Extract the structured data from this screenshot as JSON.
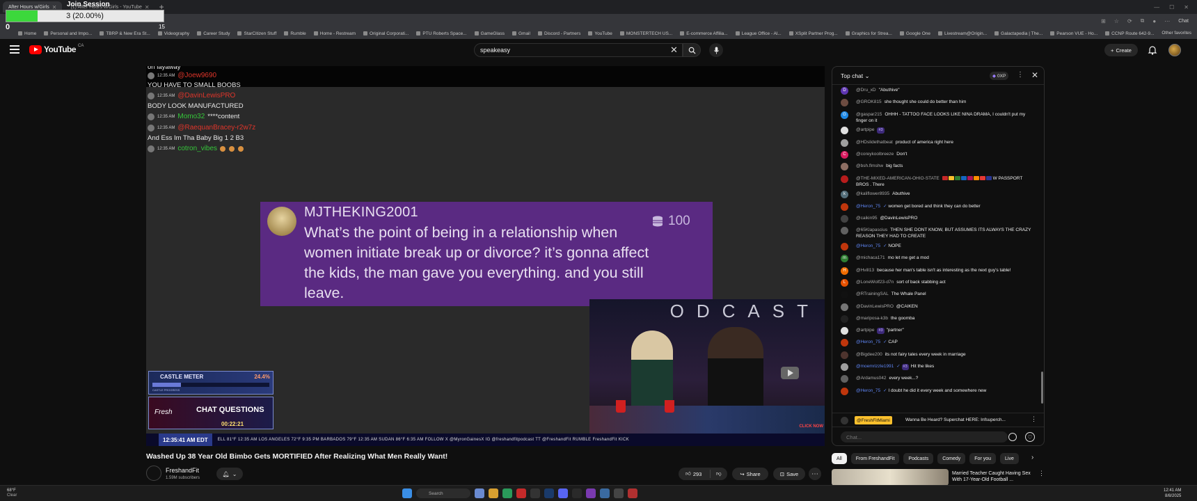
{
  "browser": {
    "tabs": [
      {
        "label": "After Hours w/Girls",
        "active": true
      },
      {
        "label": "(1) After Hours w/Girls - YouTube",
        "active": false
      }
    ],
    "chat_pill": "Chat",
    "bookmarks": [
      "Home",
      "Personal and Impo...",
      "TBRP & New Era St...",
      "Videography",
      "Career Study",
      "StarCitizen Stuff",
      "Rumble",
      "Home - Restream",
      "Original Corporati...",
      "PTU Roberts Space...",
      "GameGlass",
      "Gmail",
      "Discord - Partners",
      "YouTube",
      "MONSTERTECH US...",
      "E-commerce Affilia...",
      "League Office - Al...",
      "XSplit Partner Prog...",
      "Graphics for Strea...",
      "Google One",
      "Livestream@Origin...",
      "Galactapedia | The...",
      "Pearson VUE - Ho...",
      "CCNP Route 642-9..."
    ],
    "other_bookmarks": "Other favorites"
  },
  "join_session": {
    "title": "Join Session",
    "progress_text": "3 (20.00%)",
    "progress_fraction": 0.2,
    "min_label": "0",
    "max_label": "15"
  },
  "youtube": {
    "logo_text": "YouTube",
    "country": "CA",
    "search_value": "speakeasy",
    "create_label": "Create"
  },
  "video": {
    "overlay_lines": [
      {
        "time": "",
        "name": "",
        "text": "on layaway"
      },
      {
        "time": "12:35 AM",
        "name": "@Joew9690",
        "text": ""
      },
      {
        "time": "",
        "name": "",
        "text": "YOU HAVE TO SMALL BOOBS"
      },
      {
        "time": "12:35 AM",
        "name": "@DavinLewisPRO",
        "text": ""
      },
      {
        "time": "",
        "name": "",
        "text": "BODY LOOK MANUFACTURED"
      },
      {
        "time": "12:35 AM",
        "name": "Momo32",
        "text": "****content"
      },
      {
        "time": "12:35 AM",
        "name": "@RaequanBracey-r2w7z",
        "text": ""
      },
      {
        "time": "",
        "name": "",
        "text": "And Ess Im Tha Baby Big 1 2 B3"
      },
      {
        "time": "12:35 AM",
        "name": "cotron_vibes",
        "text": ""
      }
    ],
    "superchat": {
      "name": "MJTHEKING2001",
      "message": "What’s the point of being in a relationship when women initiate break up or divorce? it’s gonna affect the kids, the man gave you everything. and you still leave.",
      "amount": "100"
    },
    "cam_text": "ODCAST",
    "click_now": "CLICK NOW",
    "castle_meter": {
      "title": "CASTLE METER",
      "percent": "24.4%",
      "fraction": 0.244,
      "footer": "CASTLE PROGRESS"
    },
    "chat_questions": {
      "title": "CHAT QUESTIONS",
      "logo": "Fresh",
      "timer": "00:22:21"
    },
    "ticker": {
      "time": "12:35:41 AM EDT",
      "items": "ELL  81°F 12:35 AM   LOS ANGELES  72°F 9:35 PM   BARBADOS  79°F 12:35 AM   SUDAN  86°F 6:35 AM   FOLLOW  X @MyronGainesX   IG @freshandfitpodcast   TT @FreshandFit   RUMBLE FreshandFit   KICK"
    },
    "title": "Washed Up 38 Year Old Bimbo Gets MORTIFIED After Realizing What Men Really Want!",
    "channel": {
      "name": "FreshandFit",
      "subs": "1.59M subscribers"
    },
    "likes": "293",
    "share_label": "Share",
    "save_label": "Save"
  },
  "chat": {
    "header": "Top chat",
    "xp": "0XP",
    "messages": [
      {
        "author": "@Dru_xD",
        "text": "\"Abuthive\"",
        "avatar_color": "#5e35b1",
        "initial": "D"
      },
      {
        "author": "@GROK815",
        "text": "she thought she could do better than him",
        "avatar_color": "#6d4c41",
        "initial": ""
      },
      {
        "author": "@gaspar215",
        "text": "OHHH - TATTOO FACE LOOKS LIKE NINA DRAMA, I couldn't put my finger on it",
        "avatar_color": "#1e88e5",
        "initial": "G"
      },
      {
        "author": "@artpipe",
        "text": "",
        "avatar_color": "#e0e0e0",
        "initial": "",
        "member": "#3"
      },
      {
        "author": "@HDslidethatbeat",
        "text": "product of america right here",
        "avatar_color": "#9e9e9e",
        "initial": ""
      },
      {
        "author": "@coreykoolbreeze",
        "text": "Don't",
        "avatar_color": "#d81b60",
        "initial": "C"
      },
      {
        "author": "@bsh.flmshw",
        "text": "big facts",
        "avatar_color": "#8d6e63",
        "initial": ""
      },
      {
        "author": "@THE-MIXED-AMERICAN-OHIO-STATE",
        "text": "W PASSPORT BROS . There",
        "avatar_color": "#b71c1c",
        "initial": "",
        "flags": true
      },
      {
        "author": "@kaliflower8935",
        "text": "Abuthive",
        "avatar_color": "#546e7a",
        "initial": "k"
      },
      {
        "author": "@Heron_75",
        "text": "women get bored and think they can do better",
        "avatar_color": "#bf360c",
        "initial": "",
        "mod": true
      },
      {
        "author": "@caikin95",
        "text": "@DavinLewisPRO",
        "avatar_color": "#424242",
        "initial": ""
      },
      {
        "author": "@65Klapascius",
        "text": "THEN SHE DONT KNOW, BUT ASSUMES ITS ALWAYS THE CRAZY REASON THEY HAD TO CREATE",
        "avatar_color": "#616161",
        "initial": ""
      },
      {
        "author": "@Heron_75",
        "text": "NOPE",
        "avatar_color": "#bf360c",
        "initial": "",
        "mod": true
      },
      {
        "author": "@michaca171",
        "text": "mo let me get a mod",
        "avatar_color": "#2e7d32",
        "initial": "m"
      },
      {
        "author": "@Hvill13",
        "text": "because her man's table isn't as interesting as the next guy's table!",
        "avatar_color": "#ef6c00",
        "initial": "H"
      },
      {
        "author": "@LoneWolf23-d7n",
        "text": "sort of back stabbing act",
        "avatar_color": "#e65100",
        "initial": "L"
      },
      {
        "author": "@RTrainingSAL",
        "text": "The Whale Panel",
        "avatar_color": "#111111",
        "initial": ""
      },
      {
        "author": "@DavinLewisPRO",
        "text": "@CAIKEN",
        "avatar_color": "#757575",
        "initial": ""
      },
      {
        "author": "@mariposa-k3b",
        "text": "the goomba",
        "avatar_color": "#212121",
        "initial": ""
      },
      {
        "author": "@artpipe",
        "text": "\"partner\"",
        "avatar_color": "#e0e0e0",
        "initial": "",
        "member": "#3"
      },
      {
        "author": "@Heron_75",
        "text": "CAP",
        "avatar_color": "#bf360c",
        "initial": "",
        "mod": true
      },
      {
        "author": "@Bigdee200",
        "text": "its not fairy tales every week in marriage",
        "avatar_color": "#4e342e",
        "initial": ""
      },
      {
        "author": "@moemrizzle1991",
        "text": "Hit the likes",
        "avatar_color": "#9e9e9e",
        "initial": "",
        "mod": true,
        "member": "#3"
      },
      {
        "author": "@Ardamus042",
        "text": "every week...?",
        "avatar_color": "#616161",
        "initial": ""
      },
      {
        "author": "@Heron_75",
        "text": "I doubt he did it every week and somewhere new",
        "avatar_color": "#bf360c",
        "initial": "",
        "mod": true
      }
    ],
    "pinned": {
      "badge": "@FreshFitMiami",
      "text": "Wanna Be Heard? Superchat HERE: Infsuperch..."
    },
    "input_placeholder": "Chat..."
  },
  "chips": [
    "All",
    "From FreshandFit",
    "Podcasts",
    "Comedy",
    "For you",
    "Live"
  ],
  "reco": {
    "title": "Married Teacher Caught Having Sex With 17-Year-Old Football ..."
  },
  "taskbar": {
    "temp": "68°F",
    "condition": "Clear",
    "search_placeholder": "Search",
    "time": "12:41 AM",
    "date": "8/8/2025"
  },
  "colors": {
    "accent_red": "#ff0000",
    "superchat_bg": "#5a2a82",
    "mod_blue": "#5e84f1"
  }
}
